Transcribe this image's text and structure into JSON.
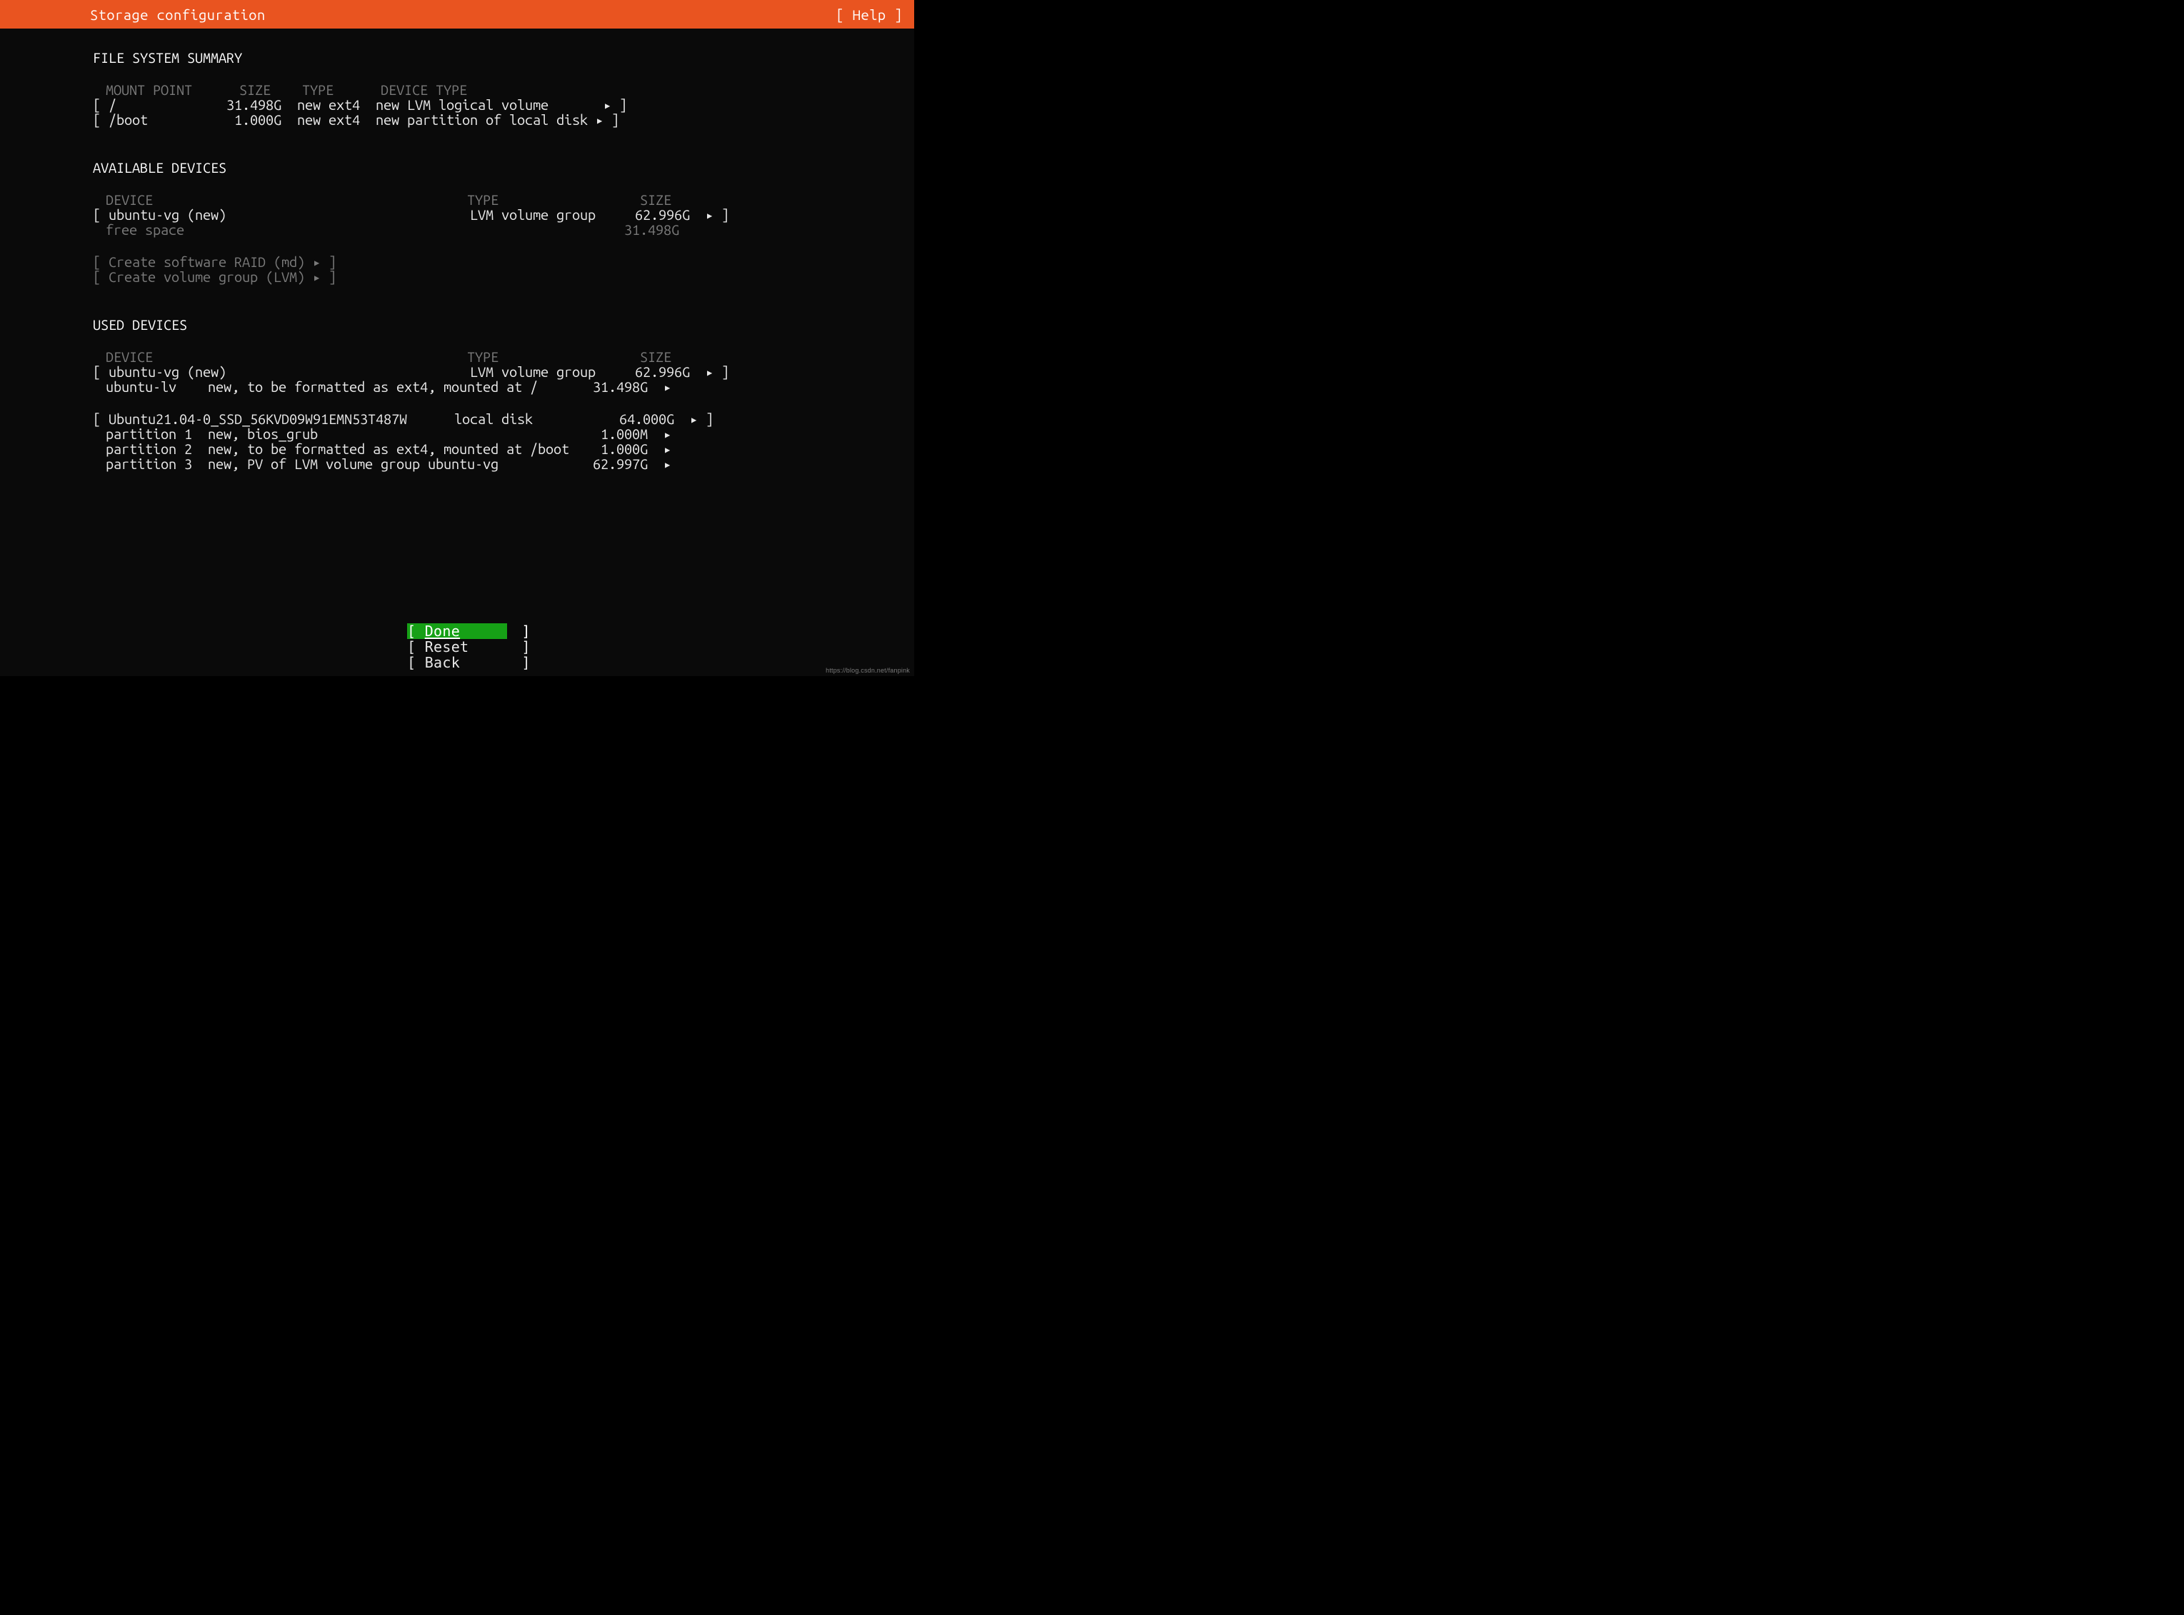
{
  "header": {
    "title": "Storage configuration",
    "help": "[ Help ]"
  },
  "fs_summary": {
    "heading": "FILE SYSTEM SUMMARY",
    "cols": {
      "mount": "MOUNT POINT",
      "size": "SIZE",
      "type": "TYPE",
      "dev": "DEVICE TYPE"
    },
    "rows": [
      {
        "mount": "/",
        "size": "31.498G",
        "type": "new ext4",
        "dev": "new LVM logical volume"
      },
      {
        "mount": "/boot",
        "size": "1.000G",
        "type": "new ext4",
        "dev": "new partition of local disk"
      }
    ]
  },
  "available": {
    "heading": "AVAILABLE DEVICES",
    "cols": {
      "device": "DEVICE",
      "type": "TYPE",
      "size": "SIZE"
    },
    "rows": [
      {
        "device": "ubuntu-vg (new)",
        "type": "LVM volume group",
        "size": "62.996G",
        "action": true
      },
      {
        "device": "free space",
        "type": "",
        "size": "31.498G",
        "dim": true
      }
    ],
    "actions": [
      "Create software RAID (md)",
      "Create volume group (LVM)"
    ]
  },
  "used": {
    "heading": "USED DEVICES",
    "cols": {
      "device": "DEVICE",
      "type": "TYPE",
      "size": "SIZE"
    },
    "groups": [
      {
        "head": {
          "device": "ubuntu-vg (new)",
          "type": "LVM volume group",
          "size": "62.996G"
        },
        "children": [
          {
            "name": "ubuntu-lv",
            "desc": "new, to be formatted as ext4, mounted at /",
            "size": "31.498G"
          }
        ]
      },
      {
        "head": {
          "device": "Ubuntu21.04-0_SSD_56KVD09W91EMN53T487W",
          "type": "local disk",
          "size": "64.000G"
        },
        "children": [
          {
            "name": "partition 1",
            "desc": "new, bios_grub",
            "size": "1.000M"
          },
          {
            "name": "partition 2",
            "desc": "new, to be formatted as ext4, mounted at /boot",
            "size": "1.000G"
          },
          {
            "name": "partition 3",
            "desc": "new, PV of LVM volume group ubuntu-vg",
            "size": "62.997G"
          }
        ]
      }
    ]
  },
  "buttons": {
    "done": "Done",
    "reset": "Reset",
    "back": "Back"
  },
  "watermark": "https://blog.csdn.net/fanpink"
}
